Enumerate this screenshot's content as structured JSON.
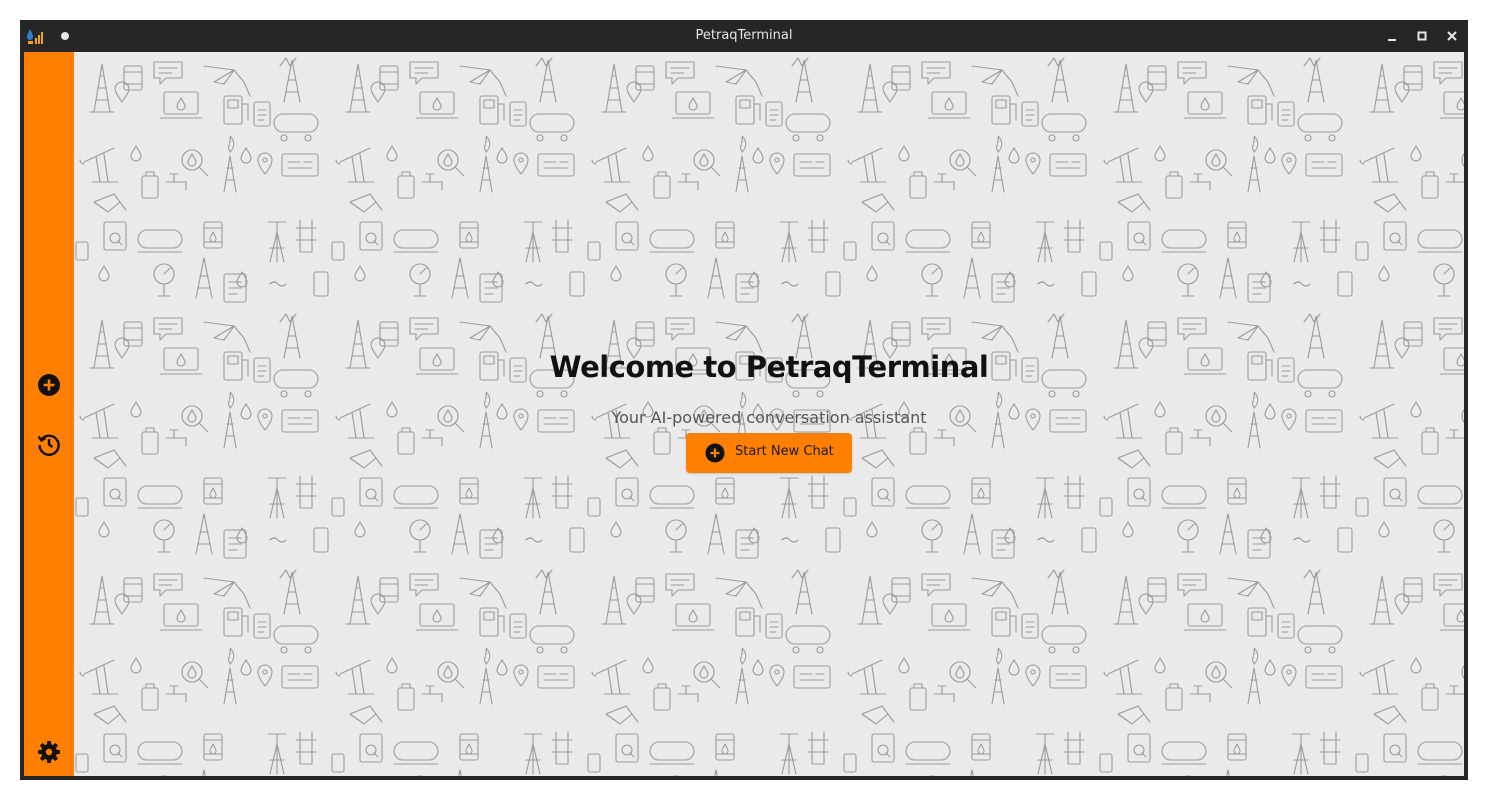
{
  "window": {
    "title": "PetraqTerminal",
    "app_icon": "oil-drop-chart-icon",
    "controls": [
      "minimize-icon",
      "maximize-icon",
      "close-icon"
    ]
  },
  "sidebar": {
    "color": "#ff7f00",
    "items": [
      {
        "name": "new-chat",
        "icon": "plus-circle-icon"
      },
      {
        "name": "history",
        "icon": "history-clock-icon"
      },
      {
        "name": "settings",
        "icon": "gear-icon"
      }
    ]
  },
  "main": {
    "background_pattern": "oil-and-gas-icons",
    "welcome_title": "Welcome to PetraqTerminal",
    "subtitle": "Your AI-powered conversation assistant",
    "start_button": {
      "label": "Start New Chat",
      "icon": "plus-circle-icon",
      "color": "#ff7f00"
    }
  }
}
